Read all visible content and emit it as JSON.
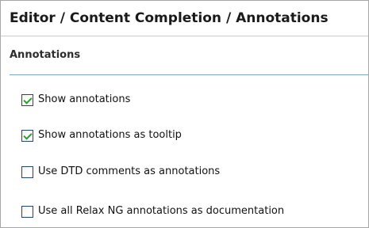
{
  "header": {
    "title": "Editor / Content Completion / Annotations"
  },
  "section": {
    "title": "Annotations"
  },
  "options": [
    {
      "label": "Show annotations",
      "checked": true
    },
    {
      "label": "Show annotations as tooltip",
      "checked": true
    },
    {
      "label": "Use DTD comments as annotations",
      "checked": false
    },
    {
      "label": "Use all Relax NG annotations as documentation",
      "checked": false
    }
  ],
  "colors": {
    "checkbox_border": "#21447a",
    "check_mark": "#2aa02a",
    "section_rule": "#7aa6c8"
  }
}
